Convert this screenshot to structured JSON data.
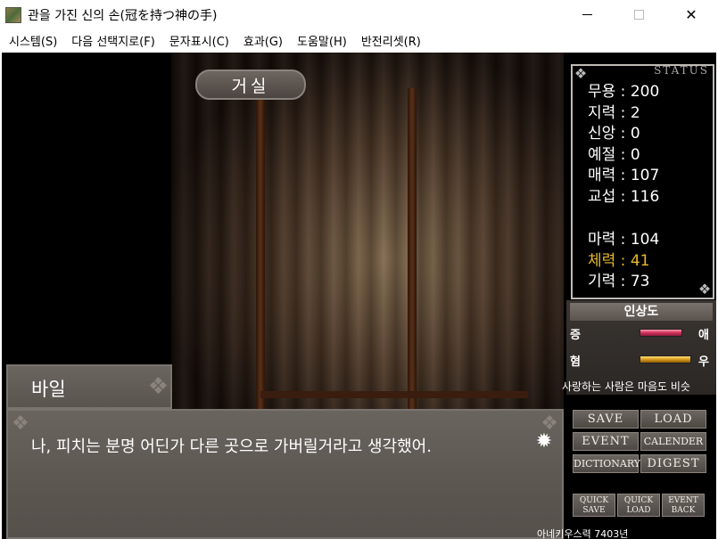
{
  "window": {
    "title": "관을 가진 신의 손(冠を持つ神の手)",
    "minimize_glyph": "—",
    "maximize_glyph": "☐",
    "close_glyph": "✕"
  },
  "menu": [
    "시스템(S)",
    "다음 선택지로(F)",
    "문자표시(C)",
    "효과(G)",
    "도움말(H)",
    "반전리셋(R)"
  ],
  "scene": {
    "location": "거실"
  },
  "status": {
    "title": "STATUS",
    "rows": [
      {
        "label": "무용 : 200"
      },
      {
        "label": "지력 : 2"
      },
      {
        "label": "신앙 : 0"
      },
      {
        "label": "예절 : 0"
      },
      {
        "label": "매력 : 107"
      },
      {
        "label": "교섭 : 116"
      },
      {
        "label": "마력 : 104"
      },
      {
        "label": "체력 : 41",
        "highlight": true
      },
      {
        "label": "기력 : 73"
      }
    ],
    "highlight_color": "#e8b92a"
  },
  "affinity": {
    "title": "인상도",
    "love_left": "증",
    "love_right": "애",
    "love_level": 0.55,
    "friend_left": "혐",
    "friend_right": "우",
    "friend_level": 0.7,
    "message": "사랑하는 사람은 마음도 비슷"
  },
  "dialogue": {
    "speaker": "바일",
    "text": "나, 피치는 분명 어딘가 다른 곳으로 가버릴거라고 생각했어.",
    "advance_icon": "sun-gear-icon"
  },
  "controls": {
    "save": "SAVE",
    "load": "LOAD",
    "event": "EVENT",
    "calender": "CALENDER",
    "dictionary": "DICTIONARY",
    "digest": "DIGEST",
    "quick_save_1": "QUICK",
    "quick_save_2": "SAVE",
    "quick_load_1": "QUICK",
    "quick_load_2": "LOAD",
    "event_back_1": "EVENT",
    "event_back_2": "BACK"
  },
  "footer": {
    "text": "아네키우스력 7403년"
  }
}
